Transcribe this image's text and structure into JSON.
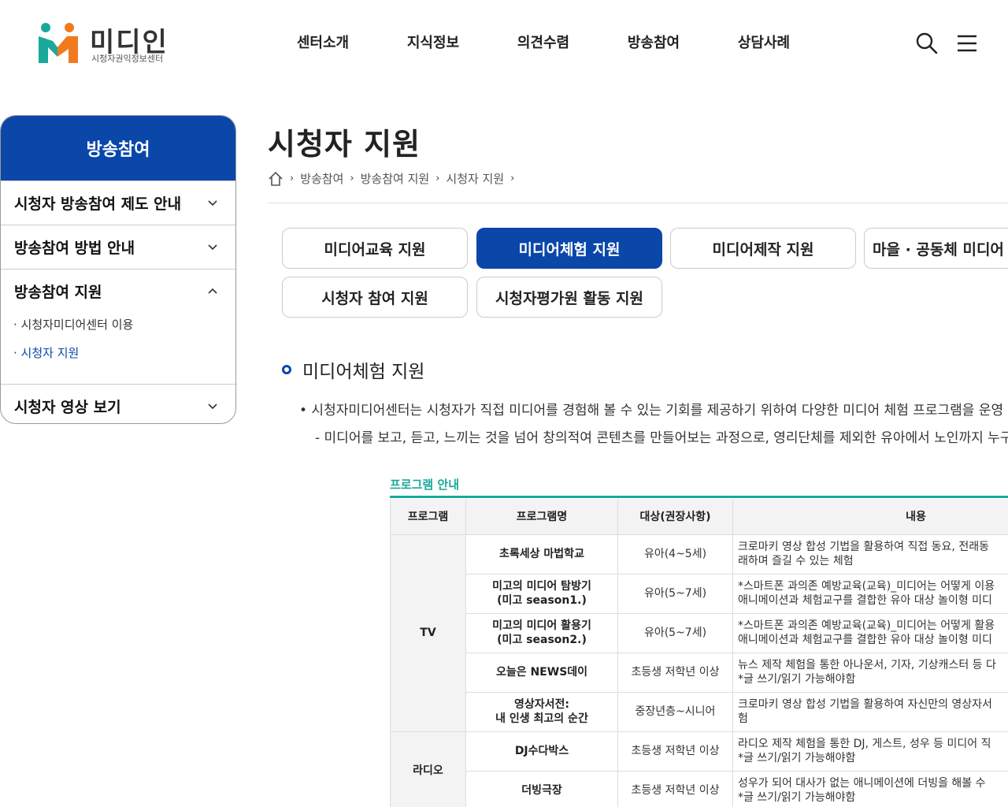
{
  "site": {
    "logo_title": "미디인",
    "logo_sub": "시청자권익정보센터"
  },
  "gnb": [
    "센터소개",
    "지식정보",
    "의견수렴",
    "방송참여",
    "상담사례"
  ],
  "lnb": {
    "title": "방송참여",
    "items": [
      {
        "label": "시청자 방송참여 제도 안내"
      },
      {
        "label": "방송참여 방법 안내"
      },
      {
        "label": "방송참여 지원",
        "sub": [
          "· 시청자미디어센터 이용",
          "· 시청자 지원"
        ]
      },
      {
        "label": "시청자 영상 보기"
      }
    ]
  },
  "page": {
    "title": "시청자 지원",
    "breadcrumb": [
      "방송참여",
      "방송참여 지원",
      "시청자 지원"
    ]
  },
  "tabs": [
    "미디어교육 지원",
    "미디어체험 지원",
    "미디어제작 지원",
    "마을 · 공동체 미디어",
    "시청자 참여 지원",
    "시청자평가원 활동 지원"
  ],
  "section": {
    "title": "미디어체험 지원",
    "desc1": "• 시청자미디어센터는 시청자가 직접 미디어를 경험해 볼 수 있는 기회를 제공하기 위하여 다양한 미디어 체험 프로그램을 운영",
    "desc2": "- 미디어를 보고, 듣고, 느끼는 것을 넘어 창의적여 콘텐츠를 만들어보는 과정으로, 영리단체를 제외한 유아에서 노인까지 누구나"
  },
  "program": {
    "label": "프로그램 안내",
    "headers": [
      "프로그램",
      "프로그램명",
      "대상(권장사항)",
      "내용"
    ],
    "categories": [
      "TV",
      "라디오"
    ],
    "rows": [
      {
        "name": "초록세상 마법학교",
        "target": "유아(4~5세)",
        "c1": "크로마키 영상 합성 기법을 활용하여 직접 동요, 전래동",
        "c2": "래하며 즐길 수 있는 체험"
      },
      {
        "name1": "미고의 미디어 탐방기",
        "name2": "(미고 season1.)",
        "target": "유아(5~7세)",
        "c1": "*스마트폰 과의존 예방교육(교육)_미디어는 어떻게 이용",
        "c2": "애니메이션과 체험교구를 결합한 유아 대상 놀이형 미디"
      },
      {
        "name1": "미고의 미디어 활용기",
        "name2": "(미고 season2.)",
        "target": "유아(5~7세)",
        "c1": "*스마트폰 과의존 예방교육(교육)_미디어는 어떻게 활용",
        "c2": "애니메이션과 체험교구를 결합한 유아 대상 놀이형 미디"
      },
      {
        "name": "오늘은 NEWS데이",
        "target": "초등생 저학년 이상",
        "c1": "뉴스 제작 체험을 통한 아나운서, 기자, 기상캐스터 등 다",
        "c2": "*글 쓰기/읽기 가능해야함"
      },
      {
        "name1": "영상자서전:",
        "name2": "내 인생 최고의 순간",
        "target": "중장년층~시니어",
        "c1": "크로마키 영상 합성 기법을 활용하여 자신만의 영상자서",
        "c2": "험"
      },
      {
        "name": "DJ수다박스",
        "target": "초등생 저학년 이상",
        "c1": "라디오 제작 체험을 통한 DJ, 게스트, 성우 등 미디어 직",
        "c2": "*글 쓰기/읽기 가능해야함"
      },
      {
        "name": "더빙극장",
        "target": "초등생 저학년 이상",
        "c1": "성우가 되어 대사가 없는 애니메이션에 더빙을 해볼 수",
        "c2": "*글 쓰기/읽기 가능해야함"
      }
    ]
  },
  "colors": {
    "primary": "#0a47a9",
    "teal": "#1aa89a",
    "logo_orange": "#f07a1e",
    "logo_green": "#1aa89a"
  },
  "icons": {
    "search": "search-icon",
    "menu": "hamburger-menu-icon",
    "home": "home-icon"
  }
}
